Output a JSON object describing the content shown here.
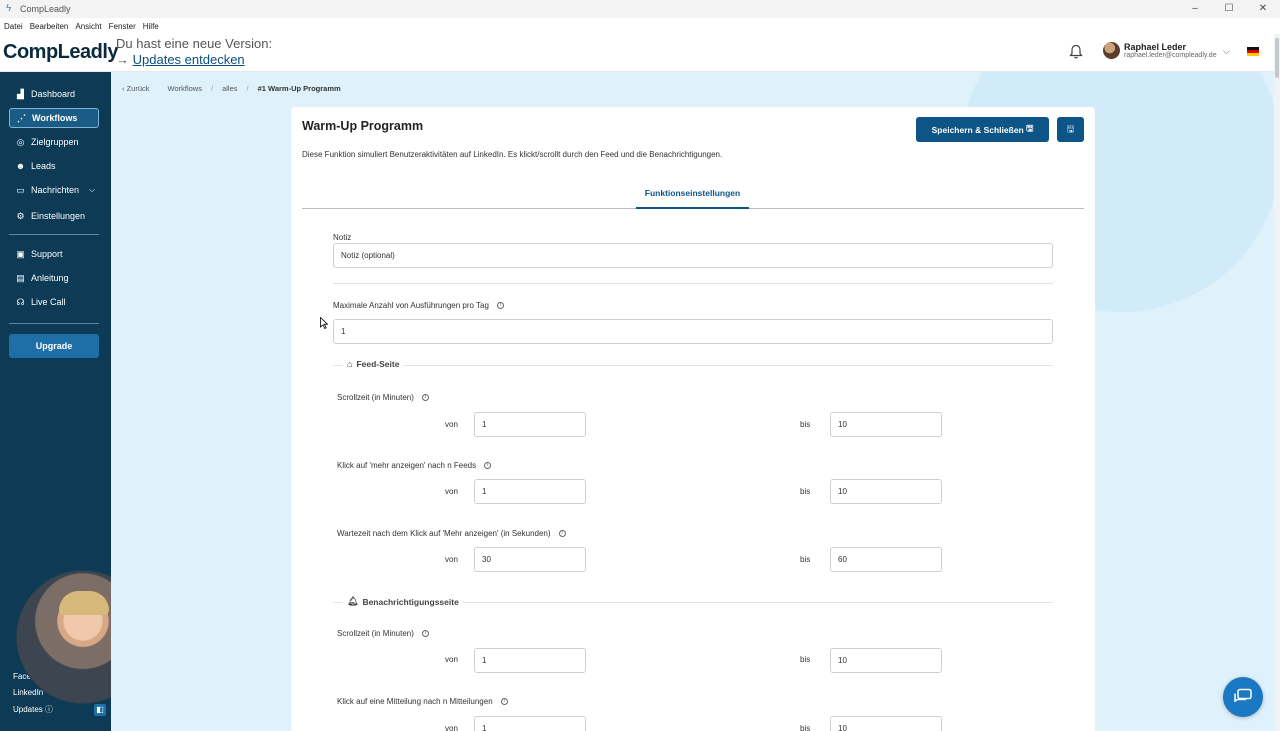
{
  "window": {
    "title": "CompLeadly",
    "controls": [
      "–",
      "☐",
      "✕"
    ]
  },
  "menu": [
    "Datei",
    "Bearbeiten",
    "Ansicht",
    "Fenster",
    "Hilfe"
  ],
  "header": {
    "logo": "CompLeadly",
    "update_line1": "Du hast eine neue Version:",
    "update_line2": "→ ",
    "update_link": "Updates entdecken",
    "user_name": "Raphael Leder",
    "user_email": "raphael.leder@compleadly.de",
    "language_flag": "de"
  },
  "sidebar": {
    "items": [
      {
        "label": "Dashboard",
        "icon": "chart-icon"
      },
      {
        "label": "Workflows",
        "icon": "workflow-icon",
        "active": true
      },
      {
        "label": "Zielgruppen",
        "icon": "target-icon"
      },
      {
        "label": "Leads",
        "icon": "users-icon"
      },
      {
        "label": "Nachrichten",
        "icon": "messages-icon"
      },
      {
        "label": "Einstellungen",
        "icon": "gear-icon"
      },
      {
        "label": "Support",
        "icon": "support-icon"
      },
      {
        "label": "Anleitung",
        "icon": "book-icon"
      },
      {
        "label": "Live Call",
        "icon": "headset-icon"
      }
    ],
    "upgrade": "Upgrade",
    "bottom": [
      "Face",
      "LinkedIn",
      "Updates"
    ]
  },
  "breadcrumb": [
    "Zurück",
    "Workflows",
    "alles",
    "#1 Warm-Up Programm"
  ],
  "card": {
    "title": "Warm-Up Programm",
    "description": "Diese Funktion simuliert Benutzeraktivitäten auf LinkedIn. Es klickt/scrollt durch den Feed und die Benachrichtigungen.",
    "save_close": "Speichern & Schließen",
    "tab": "Funktionseinstellungen",
    "note_label": "Notiz",
    "note_placeholder": "Notiz (optional)",
    "max_label": "Maximale Anzahl von Ausführungen pro Tag",
    "max_value": "1",
    "von": "von",
    "bis": "bis",
    "feed": {
      "title": "Feed-Seite",
      "rows": [
        {
          "label": "Scrollzeit (in Minuten)",
          "from": "1",
          "to": "10"
        },
        {
          "label": "Klick auf 'mehr anzeigen' nach n Feeds",
          "from": "1",
          "to": "10"
        },
        {
          "label": "Wartezeit nach dem Klick auf 'Mehr anzeigen' (in Sekunden)",
          "from": "30",
          "to": "60"
        }
      ]
    },
    "notifications": {
      "title": "Benachrichtigungsseite",
      "rows": [
        {
          "label": "Scrollzeit (in Minuten)",
          "from": "1",
          "to": "10"
        },
        {
          "label": "Klick auf eine Mitteilung nach n Mitteilungen",
          "from": "1",
          "to": "10"
        }
      ]
    }
  },
  "colors": {
    "sidebar": "#0d3a54",
    "primary": "#0d5587",
    "background": "#dff1fb"
  }
}
